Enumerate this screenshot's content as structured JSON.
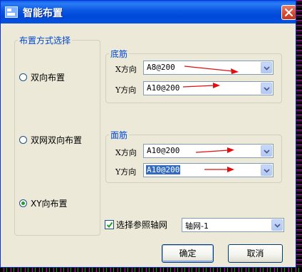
{
  "dialog": {
    "title": "智能布置",
    "close_icon": "close-icon"
  },
  "layout_mode": {
    "legend": "布置方式选择",
    "options": [
      {
        "label": "双向布置",
        "checked": false
      },
      {
        "label": "双网双向布置",
        "checked": false
      },
      {
        "label": "XY向布置",
        "checked": true
      }
    ]
  },
  "bottom_rebar": {
    "legend": "底筋",
    "x_label": "X方向",
    "x_value": "A8@200",
    "y_label": "Y方向",
    "y_value": "A10@200"
  },
  "top_rebar": {
    "legend": "面筋",
    "x_label": "X方向",
    "x_value": "A10@200",
    "y_label": "Y方向",
    "y_value": "A10@200"
  },
  "axis_ref": {
    "checkbox_label": "选择参照轴网",
    "checked": true,
    "selected": "轴网-1"
  },
  "buttons": {
    "ok": "确定",
    "cancel": "取消"
  },
  "colors": {
    "title_bar": "#0a55e0",
    "legend_text": "#0046d5",
    "annotation_arrow": "#e01010",
    "selection": "#316ac5"
  }
}
